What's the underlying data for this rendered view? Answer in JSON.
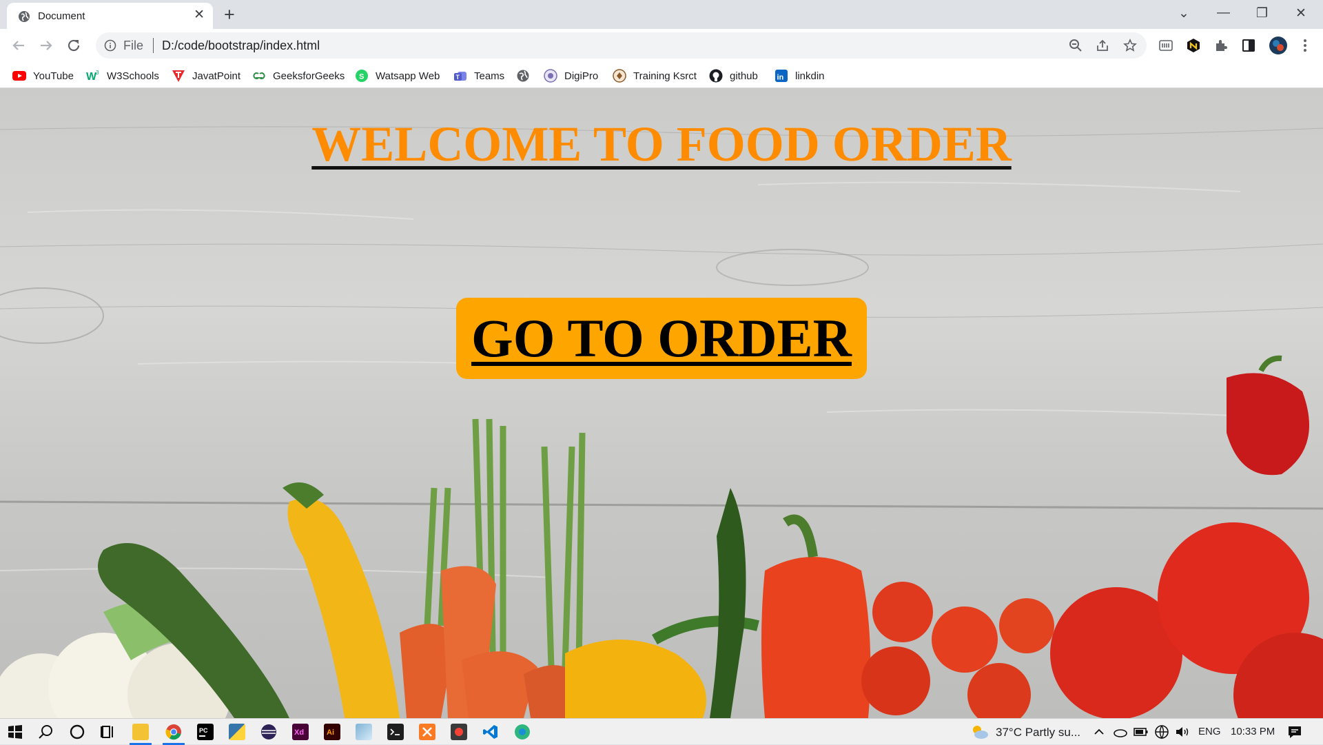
{
  "browser": {
    "tab": {
      "title": "Document",
      "close": "✕"
    },
    "new_tab": "+",
    "window": {
      "dropdown": "⌄",
      "minimize": "—",
      "restore": "❐",
      "close": "✕"
    },
    "address": {
      "scheme": "File",
      "url": "D:/code/bootstrap/index.html"
    }
  },
  "bookmarks": [
    {
      "label": "YouTube",
      "icon": "youtube-icon",
      "color": "#ff0000"
    },
    {
      "label": "W3Schools",
      "icon": "w3schools-icon",
      "color": "#04aa6d"
    },
    {
      "label": "JavatPoint",
      "icon": "javatpoint-icon",
      "color": "#e8292b"
    },
    {
      "label": "GeeksforGeeks",
      "icon": "geeksforgeeks-icon",
      "color": "#2f8d46"
    },
    {
      "label": "Watsapp Web",
      "icon": "whatsapp-icon",
      "color": "#25d366"
    },
    {
      "label": "Teams",
      "icon": "teams-icon",
      "color": "#5059c9"
    },
    {
      "label": "",
      "icon": "globe-icon",
      "color": "#5f6368"
    },
    {
      "label": "DigiPro",
      "icon": "digipro-icon",
      "color": "#7a6fb0"
    },
    {
      "label": "Training Ksrct",
      "icon": "ksrct-icon",
      "color": "#8a5a2b"
    },
    {
      "label": "github",
      "icon": "github-icon",
      "color": "#1b1f23"
    },
    {
      "label": "linkdin",
      "icon": "linkedin-icon",
      "color": "#0a66c2"
    }
  ],
  "page": {
    "heading": "WELCOME TO FOOD ORDER",
    "button": "GO TO ORDER",
    "colors": {
      "heading": "#ff8c00",
      "button_bg": "#ffa500"
    }
  },
  "taskbar": {
    "weather": "37°C  Partly su...",
    "language": "ENG",
    "time": "10:33 PM",
    "apps": [
      "start-icon",
      "search-icon",
      "cortana-icon",
      "task-view-icon",
      "file-explorer-icon",
      "chrome-icon",
      "pycharm-icon",
      "python-idle-icon",
      "eclipse-icon",
      "xd-icon",
      "illustrator-icon",
      "notepad-icon",
      "terminal-icon",
      "xampp-icon",
      "app-icon",
      "vscode-icon",
      "edge-icon"
    ]
  }
}
